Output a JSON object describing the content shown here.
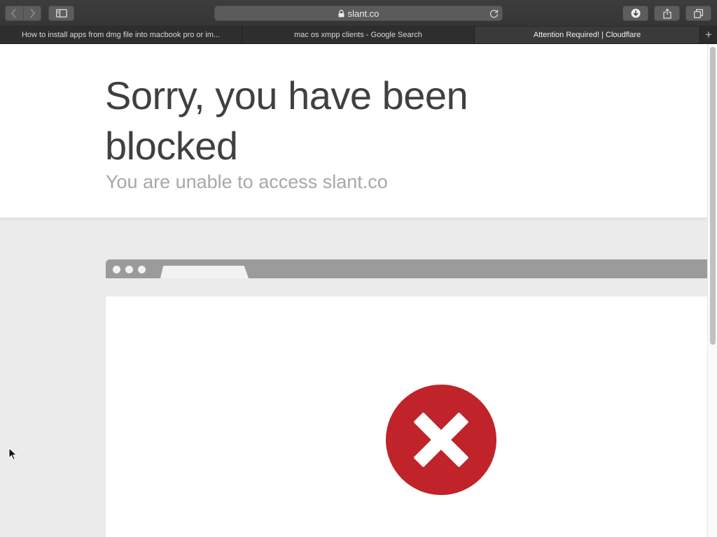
{
  "browser": {
    "address": "slant.co",
    "tabs": [
      {
        "title": "How to install apps from dmg file into macbook pro or im..."
      },
      {
        "title": "mac os xmpp clients - Google Search"
      },
      {
        "title": "Attention Required! | Cloudflare"
      }
    ],
    "new_tab_symbol": "+",
    "icons": {
      "back": "chevron-left-icon",
      "forward": "chevron-right-icon",
      "sidebar": "sidebar-icon",
      "lock": "lock-icon",
      "reload": "reload-icon",
      "download": "download-icon",
      "share": "share-icon",
      "tabs": "tabs-overview-icon"
    }
  },
  "page": {
    "headline": "Sorry, you have been blocked",
    "subheadline": "You are unable to access slant.co",
    "error_icon": "error-x-icon"
  },
  "colors": {
    "error_red": "#c0232a",
    "headline_text": "#404040",
    "subhead_text": "#a8a8a8",
    "grey_background": "#ebebeb"
  }
}
